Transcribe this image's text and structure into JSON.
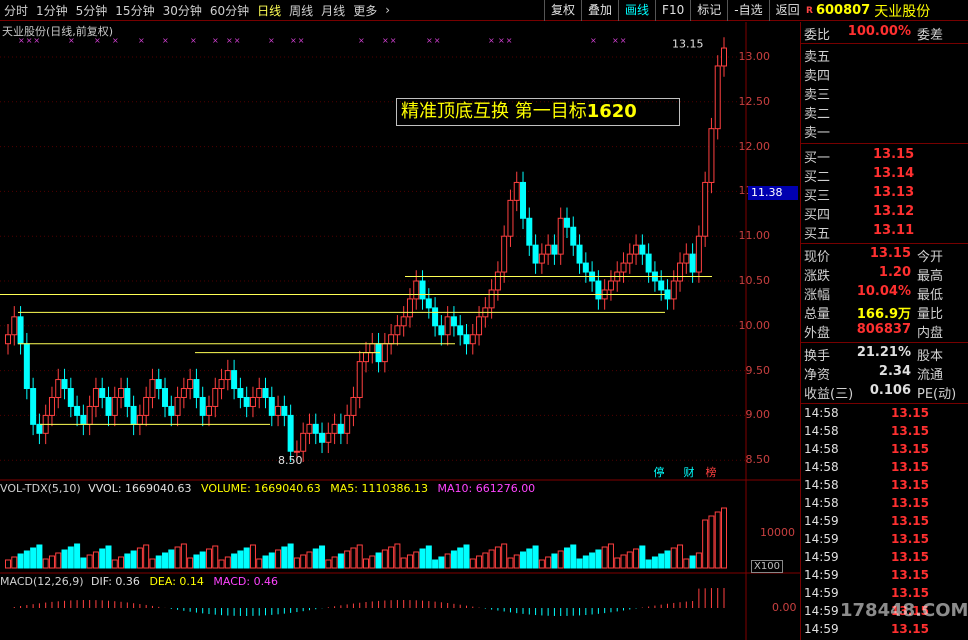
{
  "toolbar": {
    "periods": [
      "分时",
      "1分钟",
      "5分钟",
      "15分钟",
      "30分钟",
      "60分钟",
      "日线",
      "周线",
      "月线",
      "更多"
    ],
    "more_arrow": "›",
    "active_period": "日线",
    "buttons": [
      "复权",
      "叠加",
      "画线",
      "F10",
      "标记",
      "-自选",
      "返回"
    ],
    "active_button": "画线"
  },
  "stock": {
    "mark": "R",
    "code": "600807",
    "name": "天业股份"
  },
  "chart": {
    "title": "天业股份(日线,前复权)",
    "annotation_text": "精准顶底互换  第一目标",
    "annotation_num": "1620",
    "high_label": "13.15",
    "low_label": "8.50",
    "cursor_price": "11.38",
    "price_ticks": [
      "13.00",
      "12.50",
      "12.00",
      "11.50",
      "11.00",
      "10.50",
      "10.00",
      "9.50",
      "9.00",
      "8.50"
    ],
    "marks": [
      {
        "text": "停",
        "color": "#00ffff"
      },
      {
        "text": "财",
        "color": "#00ffff"
      },
      {
        "text": "榜",
        "color": "#ff4040"
      }
    ],
    "xx_marks": [
      "×××",
      "×",
      "×",
      "×",
      "×",
      "×",
      "×",
      "×",
      "××",
      "×",
      "××",
      "×",
      "××",
      "××",
      "×",
      "××",
      "×",
      "××"
    ],
    "colors": {
      "up": "#ff4040",
      "down": "#00ffff",
      "line": "#ffff55",
      "axis": "#800000"
    }
  },
  "volume_indicator": {
    "name": "VOL-TDX(5,10)",
    "vvol": "VVOL: 1669040.63",
    "volume": "VOLUME: 1669040.63",
    "ma5": "MA5: 1110386.13",
    "ma10": "MA10: 661276.00",
    "tick": "10000",
    "unit": "X100"
  },
  "macd_indicator": {
    "name": "MACD(12,26,9)",
    "dif": "DIF: 0.36",
    "dea": "DEA: 0.14",
    "macd": "MACD: 0.46",
    "tick": "0.00"
  },
  "order_book": {
    "weibi_label": "委比",
    "weibi_value": "100.00%",
    "weicha_label": "委差",
    "asks": [
      {
        "label": "卖五"
      },
      {
        "label": "卖四"
      },
      {
        "label": "卖三"
      },
      {
        "label": "卖二"
      },
      {
        "label": "卖一"
      }
    ],
    "bids": [
      {
        "label": "买一",
        "price": "13.15"
      },
      {
        "label": "买二",
        "price": "13.14"
      },
      {
        "label": "买三",
        "price": "13.13"
      },
      {
        "label": "买四",
        "price": "13.12"
      },
      {
        "label": "买五",
        "price": "13.11"
      }
    ]
  },
  "quote": {
    "rows": [
      {
        "l1": "现价",
        "v1": "13.15",
        "c1": "#ff3030",
        "l2": "今开"
      },
      {
        "l1": "涨跌",
        "v1": "1.20",
        "c1": "#ff3030",
        "l2": "最高"
      },
      {
        "l1": "涨幅",
        "v1": "10.04%",
        "c1": "#ff3030",
        "l2": "最低"
      },
      {
        "l1": "总量",
        "v1": "166.9万",
        "c1": "#ffff00",
        "l2": "量比"
      },
      {
        "l1": "外盘",
        "v1": "806837",
        "c1": "#ff3030",
        "l2": "内盘"
      }
    ],
    "rows2": [
      {
        "l1": "换手",
        "v1": "21.21%",
        "c1": "#e0e0e0",
        "l2": "股本"
      },
      {
        "l1": "净资",
        "v1": "2.34",
        "c1": "#e0e0e0",
        "l2": "流通"
      },
      {
        "l1": "收益(三)",
        "v1": "0.106",
        "c1": "#e0e0e0",
        "l2": "PE(动)"
      }
    ]
  },
  "ticks": [
    {
      "time": "14:58",
      "price": "13.15"
    },
    {
      "time": "14:58",
      "price": "13.15"
    },
    {
      "time": "14:58",
      "price": "13.15"
    },
    {
      "time": "14:58",
      "price": "13.15"
    },
    {
      "time": "14:58",
      "price": "13.15"
    },
    {
      "time": "14:58",
      "price": "13.15"
    },
    {
      "time": "14:59",
      "price": "13.15"
    },
    {
      "time": "14:59",
      "price": "13.15"
    },
    {
      "time": "14:59",
      "price": "13.15"
    },
    {
      "time": "14:59",
      "price": "13.15"
    },
    {
      "time": "14:59",
      "price": "13.15"
    },
    {
      "time": "14:59",
      "price": "13.15"
    },
    {
      "time": "14:59",
      "price": "13.15"
    }
  ],
  "watermark": "178448.COM"
}
